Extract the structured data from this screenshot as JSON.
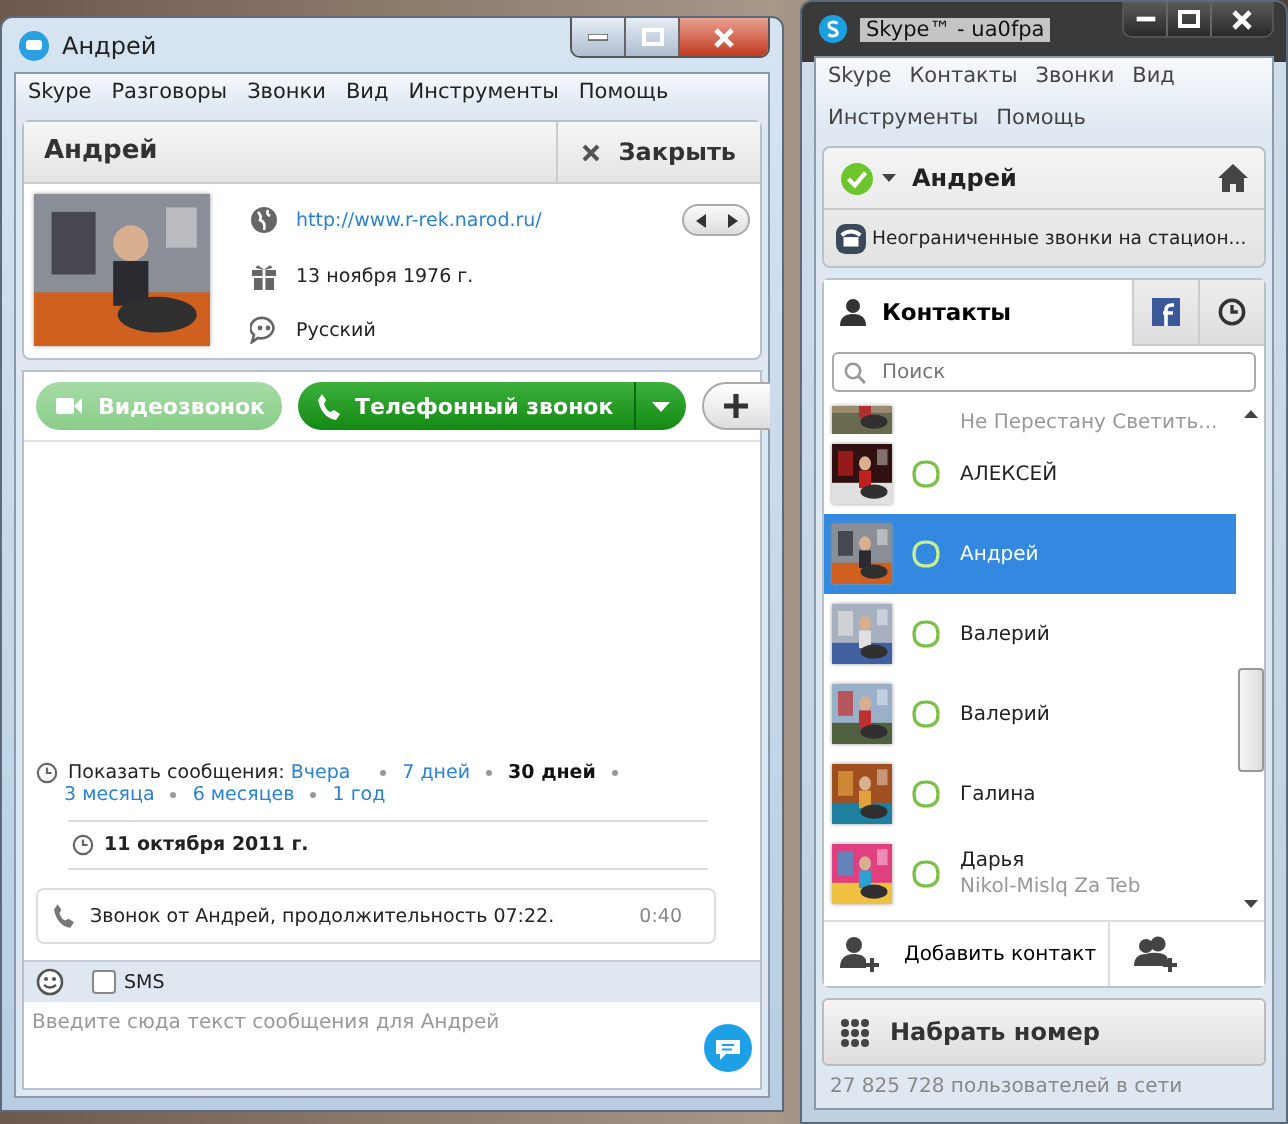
{
  "chat_window": {
    "title": "Андрей",
    "menu": [
      "Skype",
      "Разговоры",
      "Звонки",
      "Вид",
      "Инструменты",
      "Помощь"
    ],
    "profile": {
      "name": "Андрей",
      "close_label": "Закрыть",
      "website": "http://www.r-rek.narod.ru/",
      "birthday": "13 ноября 1976 г.",
      "language": "Русский"
    },
    "call_buttons": [
      {
        "kind": "video",
        "label": "Видеозвонок",
        "disabled": true
      },
      {
        "kind": "phone",
        "label": "Телефонный звонок",
        "disabled": false
      }
    ],
    "history": {
      "prefix": "Показать сообщения:",
      "periods": [
        {
          "label": "Вчера",
          "selected": false
        },
        {
          "label": "7 дней",
          "selected": false
        },
        {
          "label": "30 дней",
          "selected": true
        },
        {
          "label": "3 месяца",
          "selected": false
        },
        {
          "label": "6 месяцев",
          "selected": false
        },
        {
          "label": "1 год",
          "selected": false
        }
      ]
    },
    "date": "11 октября 2011 г.",
    "events": [
      {
        "text": "Звонок от Андрей, продолжительность 07:22.",
        "time": "0:40"
      }
    ],
    "sms": {
      "label": "SMS",
      "checked": false
    },
    "message_input": {
      "placeholder": "Введите сюда текст сообщения для Андрей"
    }
  },
  "main_window": {
    "title": "Skype™ - ua0fpa",
    "menu": [
      "Skype",
      "Контакты",
      "Звонки",
      "Вид",
      "Инструменты",
      "Помощь"
    ],
    "user": {
      "name": "Андрей"
    },
    "promo": "Неограниченные звонки на стацион...",
    "tabs": [
      {
        "kind": "contacts",
        "label": "Контакты",
        "selected": true
      },
      {
        "kind": "facebook",
        "selected": false
      },
      {
        "kind": "recent",
        "selected": false
      }
    ],
    "search": {
      "placeholder": "Поиск"
    },
    "contacts": [
      {
        "mood": "Не Перестану Светить...",
        "selected": false
      },
      {
        "name": "АЛЕКСЕЙ",
        "selected": false
      },
      {
        "name": "Андрей",
        "selected": true
      },
      {
        "name": "Валерий",
        "selected": false
      },
      {
        "name": "Валерий",
        "selected": false
      },
      {
        "name": "Галина",
        "selected": false
      },
      {
        "name": "Дарья",
        "mood": "Nikol-Mislq Za Teb",
        "selected": false
      }
    ],
    "add_contact": "Добавить контакт",
    "dial": "Набрать номер",
    "status": "27 825 728 пользователей в сети"
  }
}
